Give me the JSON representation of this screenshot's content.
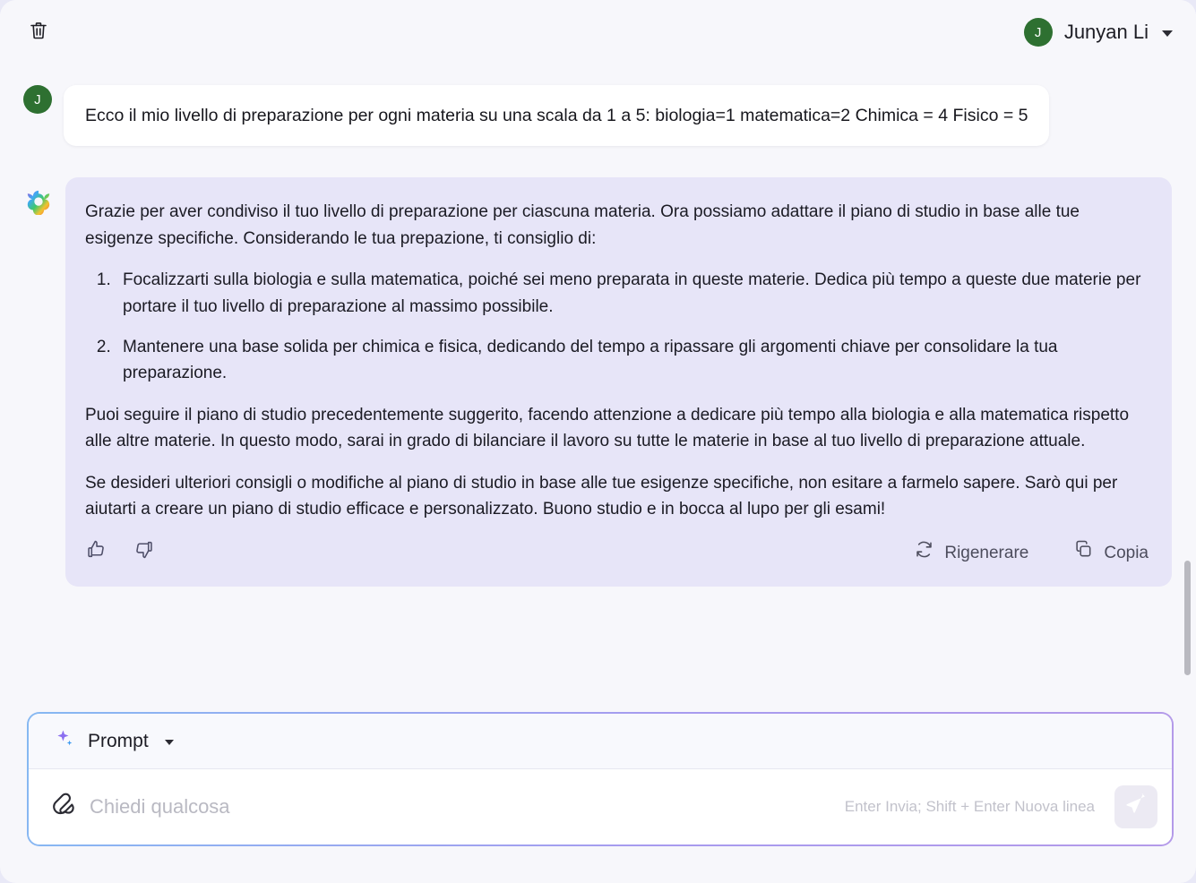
{
  "topbar": {
    "trash_icon": "trash-icon",
    "user": {
      "avatar_initial": "J",
      "name": "Junyan Li",
      "avatar_color": "#2e7031"
    }
  },
  "conversation": {
    "user_message": {
      "avatar_initial": "J",
      "text": "Ecco il mio livello di preparazione per ogni materia su una scala da 1 a 5: biologia=1 matematica=2 Chimica = 4 Fisico = 5"
    },
    "assistant_message": {
      "avatar_icon": "clover-logo-icon",
      "intro": "Grazie per aver condiviso il tuo livello di preparazione per ciascuna materia. Ora possiamo adattare il piano di studio in base alle tue esigenze specifiche. Considerando le tua prepazione, ti consiglio di:",
      "list": [
        "Focalizzarti sulla biologia e sulla matematica, poiché sei meno preparata in queste materie. Dedica più tempo a queste due materie per portare il tuo livello di preparazione al massimo possibile.",
        "Mantenere una base solida per chimica e fisica, dedicando del tempo a ripassare gli argomenti chiave per consolidare la tua preparazione."
      ],
      "paragraph_2": "Puoi seguire il piano di studio precedentemente suggerito, facendo attenzione a dedicare più tempo alla biologia e alla matematica rispetto alle altre materie. In questo modo, sarai in grado di bilanciare il lavoro su tutte le materie in base al tuo livello di preparazione attuale.",
      "paragraph_3": "Se desideri ulteriori consigli o modifiche al piano di studio in base alle tue esigenze specifiche, non esitare a farmelo sapere. Sarò qui per aiutarti a creare un piano di studio efficace e personalizzato. Buono studio e in bocca al lupo per gli esami!",
      "actions": {
        "thumbs_up_icon": "thumbs-up-icon",
        "thumbs_down_icon": "thumbs-down-icon",
        "regenerate_label": "Rigenerare",
        "regenerate_icon": "refresh-icon",
        "copy_label": "Copia",
        "copy_icon": "copy-icon"
      }
    }
  },
  "composer": {
    "prompt_label": "Prompt",
    "prompt_icon": "sparkle-icon",
    "attach_icon": "paperclip-icon",
    "input_value": "",
    "input_placeholder": "Chiedi qualcosa",
    "hint": "Enter Invia; Shift + Enter Nuova linea",
    "send_icon": "send-icon"
  },
  "colors": {
    "page_bg": "#f7f7fb",
    "assistant_bubble": "#e7e5f8",
    "user_bubble": "#ffffff",
    "accent_border_start": "#86b8f2",
    "accent_border_end": "#b49ae9",
    "avatar_green": "#2e7031"
  }
}
